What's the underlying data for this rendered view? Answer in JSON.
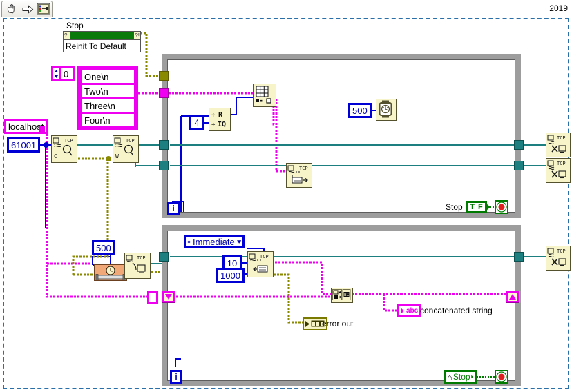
{
  "window": {
    "version_label": "2019",
    "toolbar": {
      "items": [
        {
          "name": "hand-tool-icon",
          "label": "hand"
        },
        {
          "name": "run-arrow-icon",
          "label": "run"
        },
        {
          "name": "connector-pane-icon",
          "label": "connector pane"
        }
      ]
    }
  },
  "diagram": {
    "property_node": {
      "owner_label": "Stop",
      "property": "Reinit To Default",
      "bar_left_glyph": "?!",
      "bar_right_glyph": "?!"
    },
    "index_control": {
      "value": "0",
      "name": "index"
    },
    "string_array": {
      "items": [
        "One\\n",
        "Two\\n",
        "Three\\n",
        "Four\\n"
      ]
    },
    "address_control": {
      "value": "localhost"
    },
    "port_control": {
      "value": "61001"
    },
    "tcp_open": {
      "label": "TCP",
      "sub": "C"
    },
    "tcp_read_top": {
      "label": "TCP",
      "sub": "W"
    },
    "divide_node": {
      "top_label": "R",
      "bottom_label": "IQ"
    },
    "divisor_constant": {
      "value": "4"
    },
    "index_array_node": {
      "label": "index array"
    },
    "wait_constant_top": {
      "value": "500"
    },
    "wait_timer_top": {
      "label": "wait ms"
    },
    "tcp_write_top": {
      "label": "TCP"
    },
    "iteration_top": {
      "value": "i"
    },
    "stop_top": {
      "label": "Stop",
      "tf_label": "T F",
      "terminal": "stop-condition"
    },
    "tcp_close_1": {
      "label": "TCP"
    },
    "tcp_close_2": {
      "label": "TCP"
    },
    "tcp_close_3": {
      "label": "TCP"
    },
    "listen_wait_constant": {
      "value": "500"
    },
    "listen_timer": {
      "label": "wait"
    },
    "tcp_listen": {
      "label": "TCP"
    },
    "mode_enum": {
      "value": "Immediate"
    },
    "read_count_constant": {
      "value": "10"
    },
    "read_timeout_constant": {
      "value": "1000"
    },
    "tcp_read_bottom": {
      "label": "TCP"
    },
    "concat_node": {
      "label": "concatenate strings"
    },
    "concat_indicator": {
      "glyph": "abc",
      "label": "concatenated string"
    },
    "error_out": {
      "label": "error out"
    },
    "iteration_bottom": {
      "value": "i"
    },
    "stop_bottom": {
      "label": "Stop",
      "home_glyph": "⌂",
      "terminal": "stop-condition"
    }
  },
  "colors": {
    "wire_string": "#f000f0",
    "wire_network": "#1d7f7f",
    "wire_error": "#8a8a00",
    "wire_number": "#0000d4",
    "loop_frame": "#9d9d9d",
    "vi_fill": "#f6f4c8",
    "vi_border": "#53512e",
    "green": "#007a00",
    "diagram_border": "#2a6fa8"
  }
}
